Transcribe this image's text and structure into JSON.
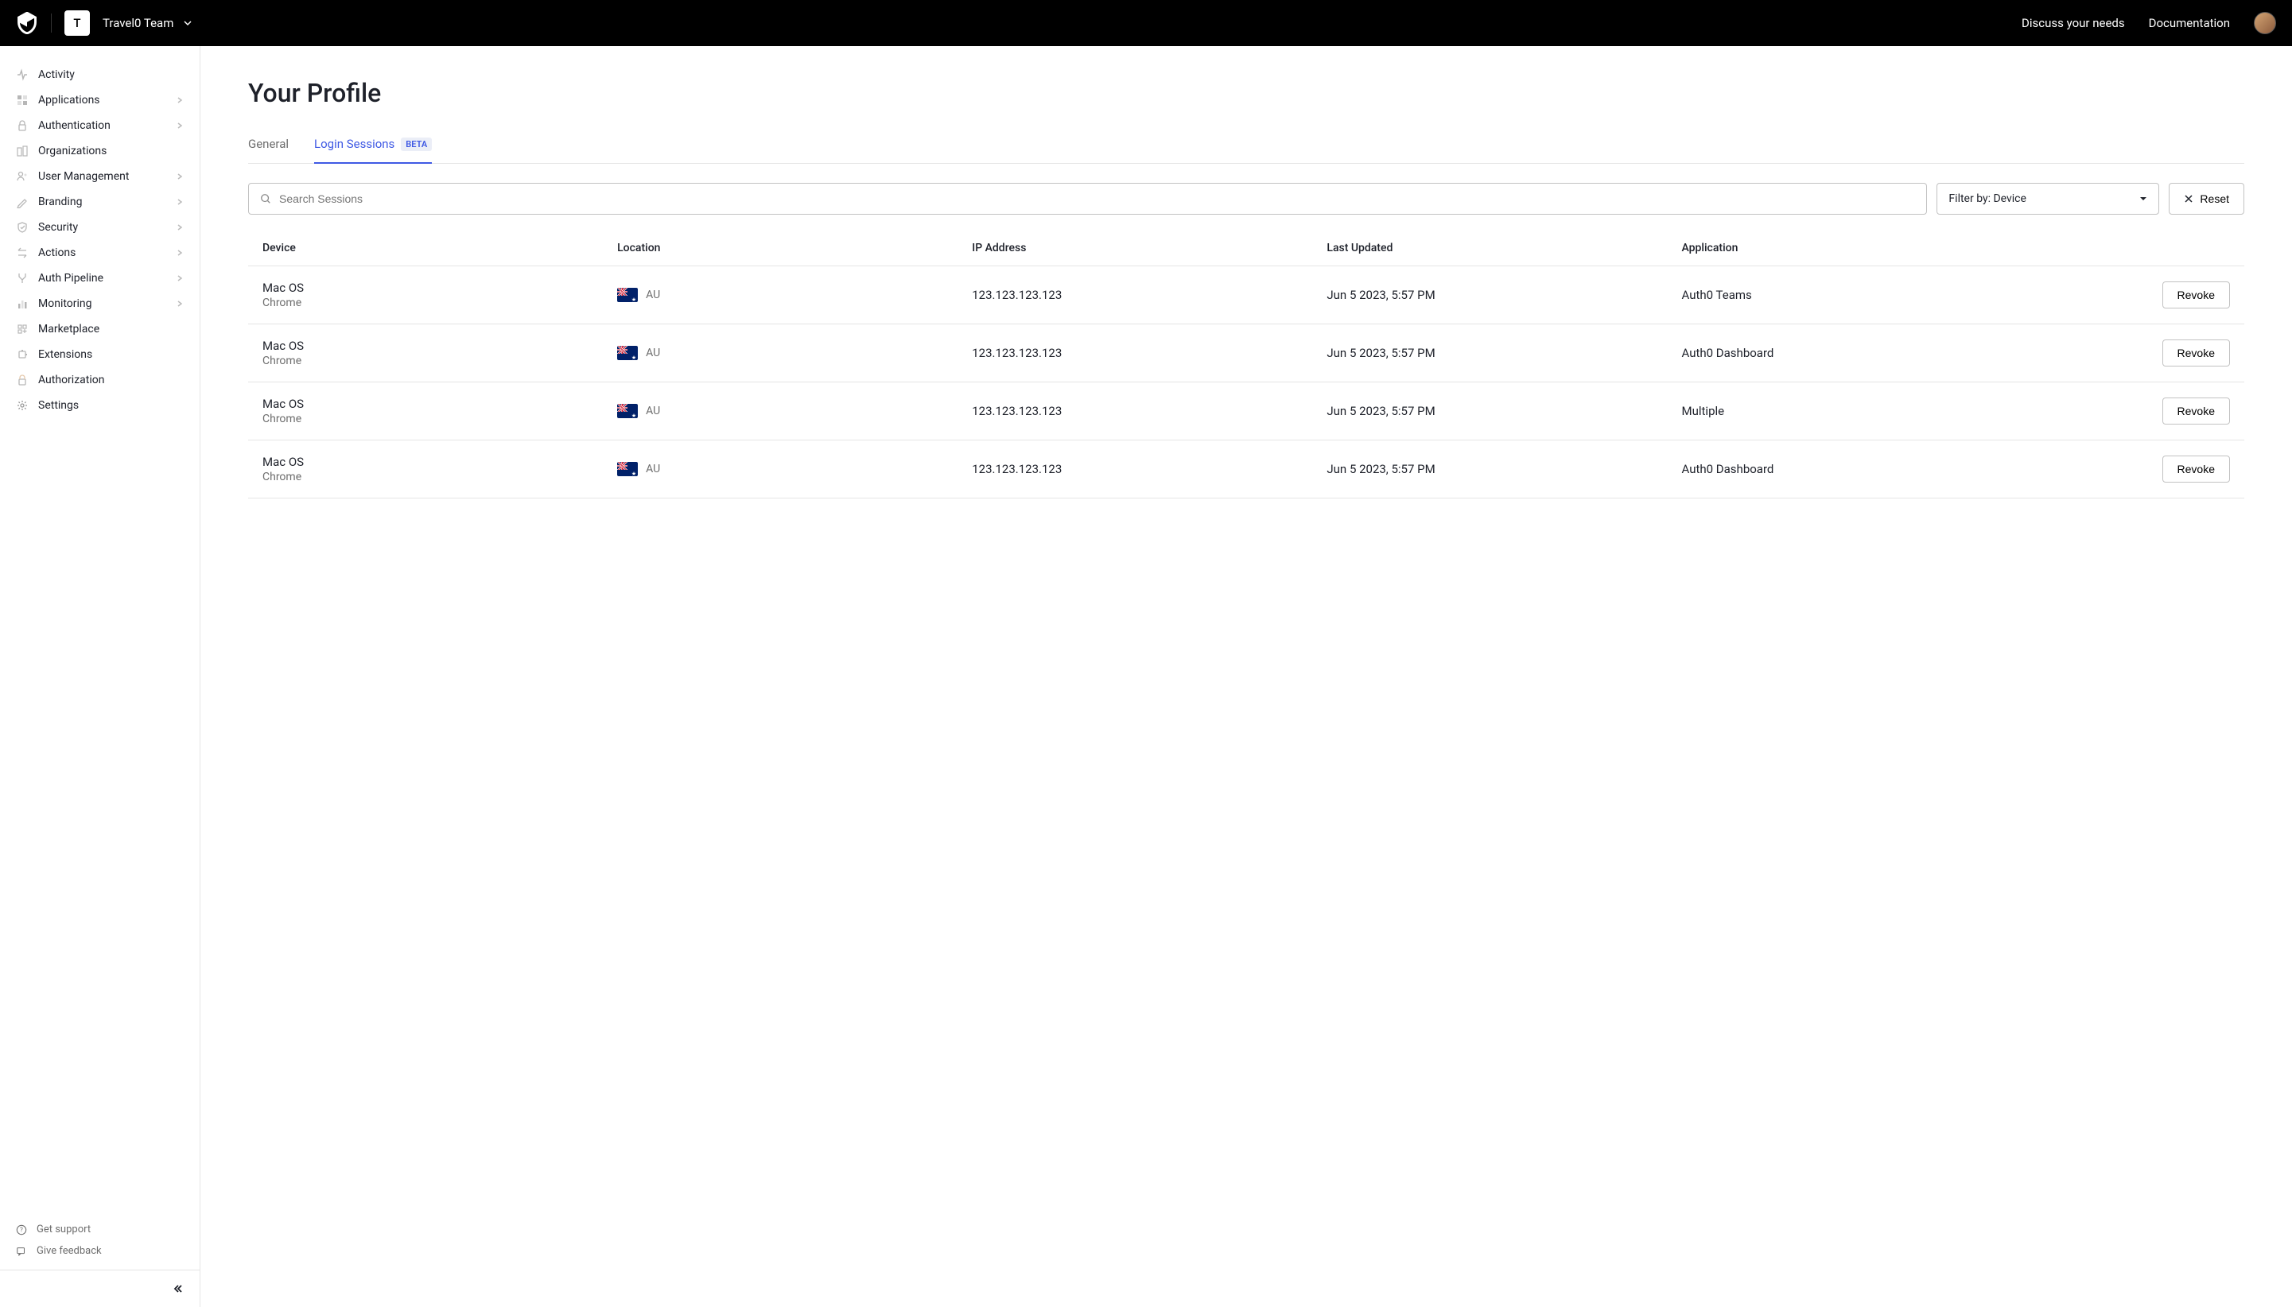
{
  "header": {
    "team_initial": "T",
    "team_name": "Travel0 Team",
    "links": {
      "discuss": "Discuss your needs",
      "documentation": "Documentation"
    }
  },
  "sidebar": {
    "items": [
      {
        "label": "Activity",
        "icon": "activity",
        "expandable": false
      },
      {
        "label": "Applications",
        "icon": "applications",
        "expandable": true
      },
      {
        "label": "Authentication",
        "icon": "authentication",
        "expandable": true
      },
      {
        "label": "Organizations",
        "icon": "organizations",
        "expandable": false
      },
      {
        "label": "User Management",
        "icon": "users",
        "expandable": true
      },
      {
        "label": "Branding",
        "icon": "branding",
        "expandable": true
      },
      {
        "label": "Security",
        "icon": "security",
        "expandable": true
      },
      {
        "label": "Actions",
        "icon": "actions",
        "expandable": true
      },
      {
        "label": "Auth Pipeline",
        "icon": "pipeline",
        "expandable": true
      },
      {
        "label": "Monitoring",
        "icon": "monitoring",
        "expandable": true
      },
      {
        "label": "Marketplace",
        "icon": "marketplace",
        "expandable": false
      },
      {
        "label": "Extensions",
        "icon": "extensions",
        "expandable": false
      },
      {
        "label": "Authorization",
        "icon": "authorization",
        "expandable": false
      },
      {
        "label": "Settings",
        "icon": "settings",
        "expandable": false
      }
    ],
    "footer": {
      "support": "Get support",
      "feedback": "Give feedback"
    }
  },
  "page": {
    "title": "Your Profile",
    "tabs": {
      "general": "General",
      "sessions": "Login Sessions",
      "badge": "BETA"
    },
    "search": {
      "placeholder": "Search Sessions"
    },
    "filter": {
      "label": "Filter by: Device"
    },
    "reset": "Reset",
    "table": {
      "headers": {
        "device": "Device",
        "location": "Location",
        "ip": "IP Address",
        "updated": "Last Updated",
        "application": "Application"
      },
      "revoke_label": "Revoke",
      "rows": [
        {
          "os": "Mac OS",
          "browser": "Chrome",
          "location": "AU",
          "ip": "123.123.123.123",
          "updated": "Jun 5 2023, 5:57 PM",
          "app": "Auth0 Teams"
        },
        {
          "os": "Mac OS",
          "browser": "Chrome",
          "location": "AU",
          "ip": "123.123.123.123",
          "updated": "Jun 5 2023, 5:57 PM",
          "app": "Auth0 Dashboard"
        },
        {
          "os": "Mac OS",
          "browser": "Chrome",
          "location": "AU",
          "ip": "123.123.123.123",
          "updated": "Jun 5 2023, 5:57 PM",
          "app": "Multiple"
        },
        {
          "os": "Mac OS",
          "browser": "Chrome",
          "location": "AU",
          "ip": "123.123.123.123",
          "updated": "Jun 5 2023, 5:57 PM",
          "app": "Auth0 Dashboard"
        }
      ]
    }
  }
}
